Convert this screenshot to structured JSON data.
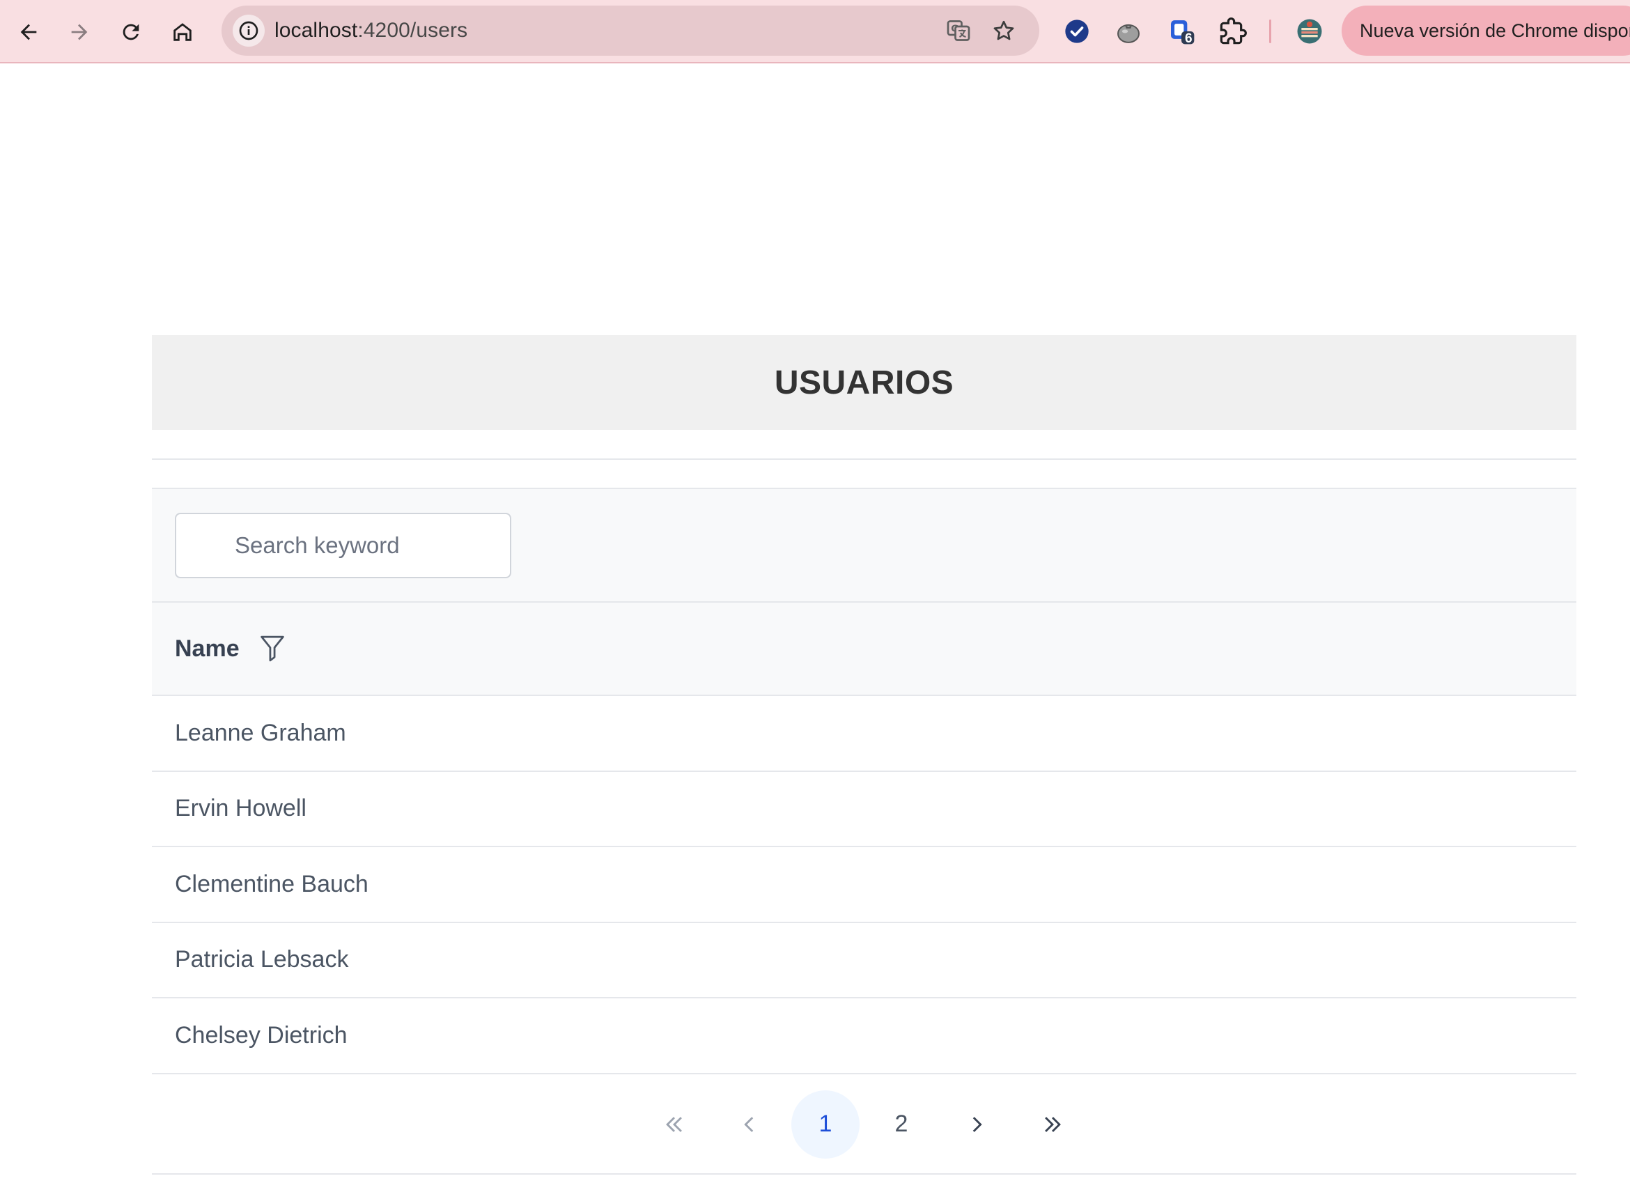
{
  "browser": {
    "url_host": "localhost",
    "url_rest": ":4200/users",
    "extension_badge": "6",
    "update_banner": "Nueva versión de Chrome disponible"
  },
  "page": {
    "title": "USUARIOS",
    "search_placeholder": "Search keyword",
    "column_name": "Name",
    "rows": [
      "Leanne Graham",
      "Ervin Howell",
      "Clementine Bauch",
      "Patricia Lebsack",
      "Chelsey Dietrich"
    ],
    "pagination": {
      "pages": [
        "1",
        "2"
      ],
      "current": "1"
    }
  },
  "colors": {
    "toolbar_bg": "#f9dfe2",
    "active_page_bg": "#eff6ff",
    "active_page_text": "#1d4ed8"
  }
}
